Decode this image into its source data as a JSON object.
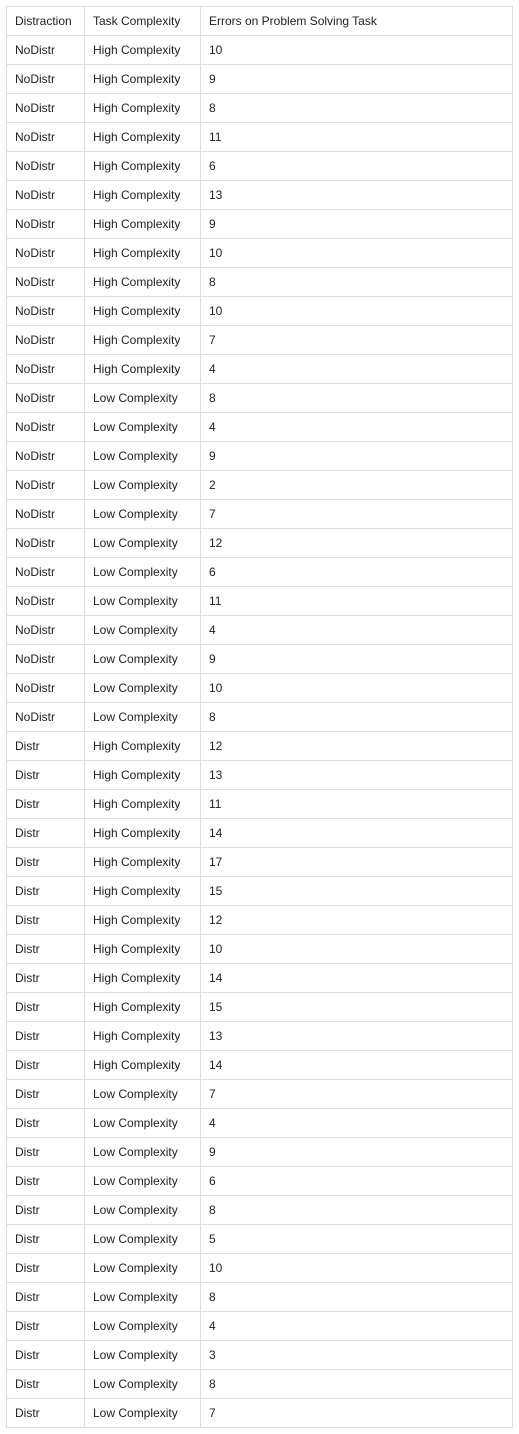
{
  "table": {
    "headers": {
      "distraction": "Distraction",
      "complexity": "Task Complexity",
      "errors": "Errors on Problem Solving Task"
    },
    "rows": [
      {
        "distraction": "NoDistr",
        "complexity": "High Complexity",
        "errors": "10"
      },
      {
        "distraction": "NoDistr",
        "complexity": "High Complexity",
        "errors": "9"
      },
      {
        "distraction": "NoDistr",
        "complexity": "High Complexity",
        "errors": "8"
      },
      {
        "distraction": "NoDistr",
        "complexity": "High Complexity",
        "errors": "11"
      },
      {
        "distraction": "NoDistr",
        "complexity": "High Complexity",
        "errors": "6"
      },
      {
        "distraction": "NoDistr",
        "complexity": "High Complexity",
        "errors": "13"
      },
      {
        "distraction": "NoDistr",
        "complexity": "High Complexity",
        "errors": "9"
      },
      {
        "distraction": "NoDistr",
        "complexity": "High Complexity",
        "errors": "10"
      },
      {
        "distraction": "NoDistr",
        "complexity": "High Complexity",
        "errors": "8"
      },
      {
        "distraction": "NoDistr",
        "complexity": "High Complexity",
        "errors": "10"
      },
      {
        "distraction": "NoDistr",
        "complexity": "High Complexity",
        "errors": "7"
      },
      {
        "distraction": "NoDistr",
        "complexity": "High Complexity",
        "errors": "4"
      },
      {
        "distraction": "NoDistr",
        "complexity": "Low Complexity",
        "errors": "8"
      },
      {
        "distraction": "NoDistr",
        "complexity": "Low Complexity",
        "errors": "4"
      },
      {
        "distraction": "NoDistr",
        "complexity": "Low Complexity",
        "errors": "9"
      },
      {
        "distraction": "NoDistr",
        "complexity": "Low Complexity",
        "errors": "2"
      },
      {
        "distraction": "NoDistr",
        "complexity": "Low Complexity",
        "errors": "7"
      },
      {
        "distraction": "NoDistr",
        "complexity": "Low Complexity",
        "errors": "12"
      },
      {
        "distraction": "NoDistr",
        "complexity": "Low Complexity",
        "errors": "6"
      },
      {
        "distraction": "NoDistr",
        "complexity": "Low Complexity",
        "errors": "11"
      },
      {
        "distraction": "NoDistr",
        "complexity": "Low Complexity",
        "errors": "4"
      },
      {
        "distraction": "NoDistr",
        "complexity": "Low Complexity",
        "errors": "9"
      },
      {
        "distraction": "NoDistr",
        "complexity": "Low Complexity",
        "errors": "10"
      },
      {
        "distraction": "NoDistr",
        "complexity": "Low Complexity",
        "errors": "8"
      },
      {
        "distraction": "Distr",
        "complexity": "High Complexity",
        "errors": "12"
      },
      {
        "distraction": "Distr",
        "complexity": "High Complexity",
        "errors": "13"
      },
      {
        "distraction": "Distr",
        "complexity": "High Complexity",
        "errors": "11"
      },
      {
        "distraction": "Distr",
        "complexity": "High Complexity",
        "errors": "14"
      },
      {
        "distraction": "Distr",
        "complexity": "High Complexity",
        "errors": "17"
      },
      {
        "distraction": "Distr",
        "complexity": "High Complexity",
        "errors": "15"
      },
      {
        "distraction": "Distr",
        "complexity": "High Complexity",
        "errors": "12"
      },
      {
        "distraction": "Distr",
        "complexity": "High Complexity",
        "errors": "10"
      },
      {
        "distraction": "Distr",
        "complexity": "High Complexity",
        "errors": "14"
      },
      {
        "distraction": "Distr",
        "complexity": "High Complexity",
        "errors": "15"
      },
      {
        "distraction": "Distr",
        "complexity": "High Complexity",
        "errors": "13"
      },
      {
        "distraction": "Distr",
        "complexity": "High Complexity",
        "errors": "14"
      },
      {
        "distraction": "Distr",
        "complexity": "Low Complexity",
        "errors": "7"
      },
      {
        "distraction": "Distr",
        "complexity": "Low Complexity",
        "errors": "4"
      },
      {
        "distraction": "Distr",
        "complexity": "Low Complexity",
        "errors": "9"
      },
      {
        "distraction": "Distr",
        "complexity": "Low Complexity",
        "errors": "6"
      },
      {
        "distraction": "Distr",
        "complexity": "Low Complexity",
        "errors": "8"
      },
      {
        "distraction": "Distr",
        "complexity": "Low Complexity",
        "errors": "5"
      },
      {
        "distraction": "Distr",
        "complexity": "Low Complexity",
        "errors": "10"
      },
      {
        "distraction": "Distr",
        "complexity": "Low Complexity",
        "errors": "8"
      },
      {
        "distraction": "Distr",
        "complexity": "Low Complexity",
        "errors": "4"
      },
      {
        "distraction": "Distr",
        "complexity": "Low Complexity",
        "errors": "3"
      },
      {
        "distraction": "Distr",
        "complexity": "Low Complexity",
        "errors": "8"
      },
      {
        "distraction": "Distr",
        "complexity": "Low Complexity",
        "errors": "7"
      }
    ]
  }
}
